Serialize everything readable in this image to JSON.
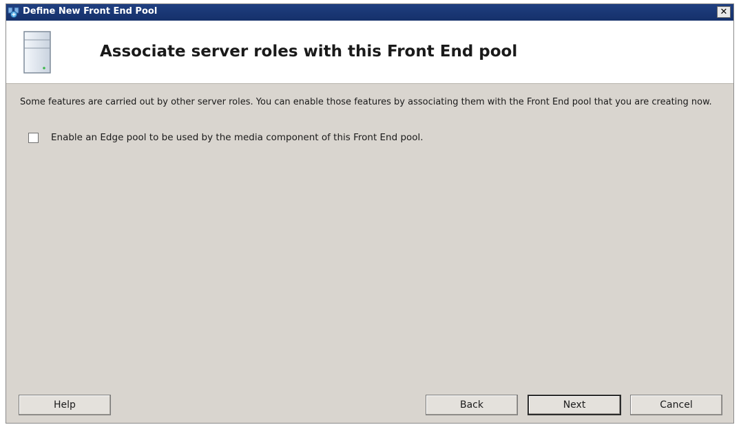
{
  "window": {
    "title": "Define New Front End Pool",
    "close_label": "✕"
  },
  "header": {
    "title": "Associate server roles with this Front End pool"
  },
  "content": {
    "description": "Some features are carried out by other server roles. You can enable those features by associating them with the Front End pool that you are creating now.",
    "edge_pool_checkbox": {
      "label": "Enable an Edge pool to be used by the media component of this Front End pool.",
      "checked": false
    }
  },
  "buttons": {
    "help": "Help",
    "back": "Back",
    "next": "Next",
    "cancel": "Cancel"
  },
  "icons": {
    "app": "server-pool-icon",
    "header": "server-tower-icon",
    "close": "close-icon"
  },
  "colors": {
    "titlebar": "#1f3f80",
    "dialog_background": "#d9d5cf",
    "header_background": "#ffffff"
  }
}
